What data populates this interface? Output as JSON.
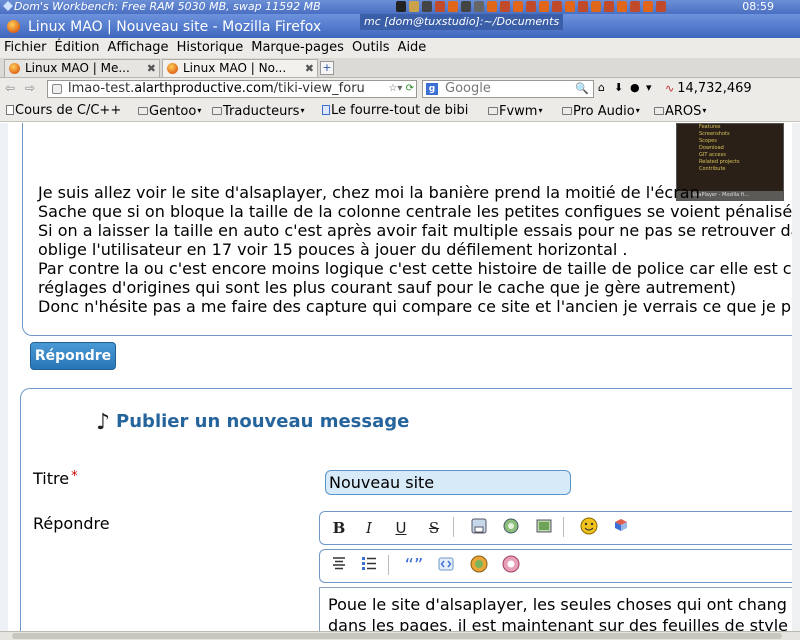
{
  "workbench": {
    "title": "Dom's Workbench:  Free RAM 5030 MB, swap 11592 MB",
    "clock": "08:59"
  },
  "window": {
    "title": "Linux MAO | Nouveau site - Mozilla Firefox",
    "terminal_title": "mc [dom@tuxstudio]:~/Documents"
  },
  "menu": [
    "Fichier",
    "Édition",
    "Affichage",
    "Historique",
    "Marque-pages",
    "Outils",
    "Aide"
  ],
  "tabs": [
    {
      "label": "Linux MAO | Me...",
      "active": false
    },
    {
      "label": "Linux MAO | No...",
      "active": true
    }
  ],
  "nav": {
    "url_prefix": "lmao-test.",
    "url_domain": "alarthproductive.com",
    "url_rest": "/tiki-view_foru",
    "search_placeholder": "Google",
    "counter": "14,732,469"
  },
  "bookmarks": [
    "Cours de C/C++",
    "Gentoo",
    "Traducteurs",
    "Le fourre-tout de bibi",
    "Fvwm",
    "Pro Audio",
    "AROS"
  ],
  "thumbnail": {
    "links": [
      "Features",
      "Screenshots",
      "Scopes",
      "Download",
      "GIT access",
      "Related projects",
      "Contribute"
    ],
    "status": "AlsaPlayer - Mozilla fi..."
  },
  "post": {
    "lines": [
      "Je suis allez voir le site d'alsaplayer, chez moi la banière prend la moitié de l'écran",
      "Sache que si on bloque la taille de la colonne centrale les petites configues se voient pénalisée du",
      "Si on a laisser la taille en auto c'est après avoir fait multiple essais pour ne pas se retrouver dans c",
      "oblige l'utilisateur en 17 voir 15 pouces à jouer du défilement horizontal .",
      "Par contre la ou c'est encore moins logique c'est cette histoire de taille de police car elle est casie",
      "réglages d'origines qui sont les plus courant sauf pour le cache que je gère autrement)",
      "Donc n'hésite pas a me faire des capture qui compare ce site et l'ancien je verrais ce que je peux"
    ]
  },
  "reply_button": "Répondre",
  "new_message": {
    "heading": "Publier un nouveau message",
    "title_label": "Titre",
    "required_mark": "*",
    "title_value": "Nouveau site",
    "reply_label": "Répondre",
    "editor_lines": [
      "Poue le site d'alsaplayer, les seules choses qui ont chang",
      "dans les pages, il est maintenant sur des feuilles de style"
    ]
  },
  "colors": {
    "heading": "#26649c",
    "button": "#2875b6",
    "border": "#6f98c7",
    "title_bar": "#4a6fc2"
  }
}
